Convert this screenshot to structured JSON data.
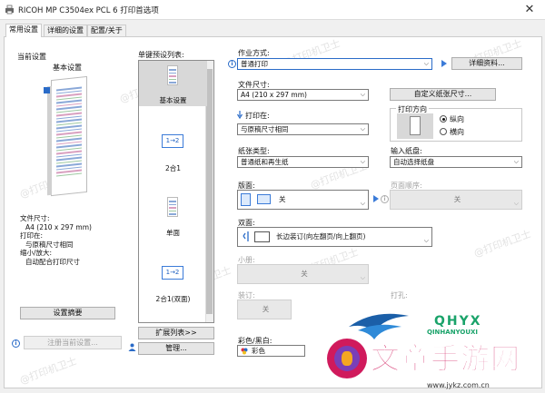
{
  "window": {
    "title": "RICOH MP C3504ex PCL 6 打印首选项",
    "close_glyph": "✕"
  },
  "tabs": [
    {
      "label": "常用设置",
      "active": true
    },
    {
      "label": "详细的设置",
      "active": false
    },
    {
      "label": "配置/关于",
      "active": false
    }
  ],
  "current": {
    "title": "当前设置",
    "name": "基本设置",
    "summary": {
      "paper_label": "文件尺寸:",
      "paper_value": "A4 (210 x 297 mm)",
      "print_on_label": "打印在:",
      "print_on_value": "与原稿尺寸相同",
      "shrink_label": "缩小/放大:",
      "shrink_value": "自动配合打印尺寸"
    },
    "summary_button": "设置摘要",
    "register_button": "注册当前设置..."
  },
  "presets": {
    "label": "单键预设列表:",
    "items": [
      {
        "name": "基本设置",
        "selected": true
      },
      {
        "name": "2合1",
        "selected": false,
        "badge": "1→2"
      },
      {
        "name": "单面",
        "selected": false
      },
      {
        "name": "2合1(双面)",
        "selected": false,
        "badge": "1→2"
      }
    ],
    "expand_button": "扩展列表>>",
    "manage_button": "管理..."
  },
  "settings": {
    "job_type": {
      "label": "作业方式:",
      "value": "普通打印",
      "details_button": "详细资料..."
    },
    "paper_size": {
      "label": "文件尺寸:",
      "value": "A4 (210 x 297 mm)",
      "custom_button": "自定义纸张尺寸..."
    },
    "print_on": {
      "label": "打印在:",
      "value": "与原稿尺寸相同"
    },
    "orientation": {
      "label": "打印方向",
      "portrait": "纵向",
      "landscape": "横向",
      "selected": "纵向"
    },
    "paper_type": {
      "label": "纸张类型:",
      "value": "普通纸和再生纸"
    },
    "input_tray": {
      "label": "输入纸盘:",
      "value": "自动选择纸盘"
    },
    "layout": {
      "label": "版面:",
      "value": "关"
    },
    "page_order": {
      "label": "页面顺序:",
      "value": "关"
    },
    "duplex": {
      "label": "双面:",
      "value": "长边装订(向左翻页/向上翻页)"
    },
    "booklet": {
      "label": "小册:",
      "value": "关"
    },
    "binding": {
      "label": "装订:",
      "value": "关"
    },
    "punch": {
      "label": "打孔:"
    },
    "color": {
      "label": "彩色/黑白:",
      "value": "彩色"
    }
  },
  "watermark": {
    "text": "@打印机卫士"
  },
  "overlay_logo": {
    "brand": "QHYX",
    "brand_sub": "QINHANYOUXI",
    "site_text": "文章手游网",
    "url_text": "www.jykz.com.cn",
    "colors": {
      "brand": "#1aa36a",
      "site": "#d01a5c"
    }
  }
}
